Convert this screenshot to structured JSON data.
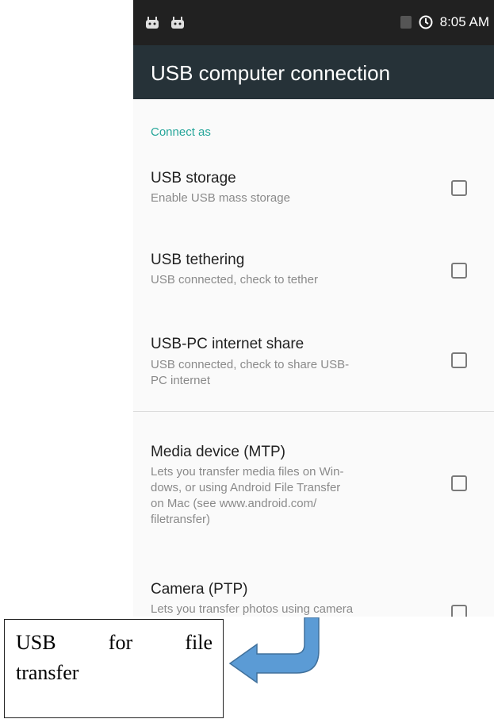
{
  "status_bar": {
    "time": "8:05 AM"
  },
  "toolbar": {
    "title": "USB computer connection"
  },
  "section": {
    "header": "Connect as"
  },
  "items": [
    {
      "title": "USB storage",
      "summary": "Enable USB mass storage",
      "checked": false
    },
    {
      "title": "USB tethering",
      "summary": "USB connected, check to tether",
      "checked": false
    },
    {
      "title": "USB-PC internet share",
      "summary_lines": [
        "USB connected, check to share USB-",
        "PC internet"
      ],
      "checked": false
    },
    {
      "title": "Media device (MTP)",
      "summary_lines": [
        "Lets you transfer media files on Win-",
        "dows, or using Android File Transfer",
        "on Mac (see www.android.com/",
        "filetransfer)"
      ],
      "checked": false
    },
    {
      "title": "Camera (PTP)",
      "summary": "Lets you transfer photos using camera",
      "checked": false
    }
  ],
  "callout": {
    "words_line1": [
      "USB",
      "for",
      "file"
    ],
    "line2": "transfer"
  },
  "colors": {
    "status_bar": "#212121",
    "toolbar": "#263238",
    "accent": "#26a69a",
    "arrow_fill": "#5b9bd5",
    "arrow_stroke": "#41719c"
  },
  "icons": [
    "android-notification-icon",
    "android-notification-icon",
    "battery-icon",
    "sync-icon",
    "arrow-icon"
  ]
}
